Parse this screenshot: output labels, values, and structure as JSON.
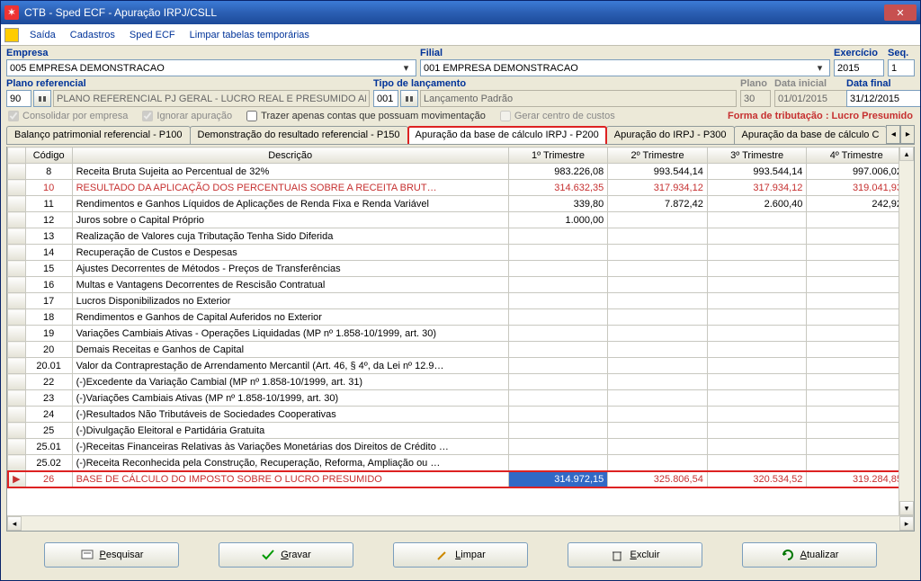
{
  "title": "CTB - Sped ECF - Apuração IRPJ/CSLL",
  "menu": {
    "saida": "Saída",
    "cadastros": "Cadastros",
    "sped": "Sped ECF",
    "limpar": "Limpar tabelas temporárias"
  },
  "fields": {
    "empresa": {
      "label": "Empresa",
      "value": "005 EMPRESA DEMONSTRACAO"
    },
    "filial": {
      "label": "Filial",
      "value": "001 EMPRESA DEMONSTRACAO"
    },
    "exercicio": {
      "label": "Exercício",
      "value": "2015"
    },
    "seq": {
      "label": "Seq.",
      "value": "1"
    },
    "plano_ref": {
      "label": "Plano referencial",
      "code": "90",
      "value": "PLANO REFERENCIAL PJ GERAL - LUCRO REAL E PRESUMIDO AN"
    },
    "tipo_lanc": {
      "label": "Tipo de lançamento",
      "code": "001",
      "value": "Lançamento Padrão"
    },
    "plano": {
      "label": "Plano",
      "value": "30"
    },
    "data_ini": {
      "label": "Data inicial",
      "value": "01/01/2015"
    },
    "data_fim": {
      "label": "Data final",
      "value": "31/12/2015"
    }
  },
  "checks": {
    "consolidar": "Consolidar por empresa",
    "ignorar": "Ignorar apuração",
    "trazer": "Trazer apenas contas que possuam movimentação",
    "gerar": "Gerar centro de custos"
  },
  "tribut": "Forma de tributação : Lucro Presumido",
  "tabs": [
    "Balanço patrimonial referencial - P100",
    "Demonstração do resultado referencial - P150",
    "Apuração da base de cálculo IRPJ - P200",
    "Apuração do IRPJ - P300",
    "Apuração da base de cálculo C"
  ],
  "grid": {
    "headers": [
      "Código",
      "Descrição",
      "1º Trimestre",
      "2º Trimestre",
      "3º Trimestre",
      "4º Trimestre"
    ],
    "rows": [
      {
        "c": "8",
        "d": "Receita Bruta Sujeita ao Percentual de 32%",
        "v": [
          "983.226,08",
          "993.544,14",
          "993.544,14",
          "997.006,02"
        ]
      },
      {
        "c": "10",
        "d": "RESULTADO DA APLICAÇÃO DOS PERCENTUAIS SOBRE A RECEITA BRUT…",
        "v": [
          "314.632,35",
          "317.934,12",
          "317.934,12",
          "319.041,93"
        ],
        "red": true
      },
      {
        "c": "11",
        "d": "Rendimentos e Ganhos Líquidos de Aplicações de Renda Fixa e Renda Variável",
        "v": [
          "339,80",
          "7.872,42",
          "2.600,40",
          "242,92"
        ]
      },
      {
        "c": "12",
        "d": "Juros sobre o Capital Próprio",
        "v": [
          "1.000,00",
          "",
          "",
          ""
        ]
      },
      {
        "c": "13",
        "d": "Realização de Valores cuja Tributação Tenha Sido Diferida",
        "v": [
          "",
          "",
          "",
          ""
        ]
      },
      {
        "c": "14",
        "d": "Recuperação de Custos e Despesas",
        "v": [
          "",
          "",
          "",
          ""
        ]
      },
      {
        "c": "15",
        "d": "Ajustes Decorrentes de Métodos - Preços de Transferências",
        "v": [
          "",
          "",
          "",
          ""
        ]
      },
      {
        "c": "16",
        "d": "Multas e Vantagens Decorrentes de Rescisão Contratual",
        "v": [
          "",
          "",
          "",
          ""
        ]
      },
      {
        "c": "17",
        "d": "Lucros Disponibilizados no Exterior",
        "v": [
          "",
          "",
          "",
          ""
        ]
      },
      {
        "c": "18",
        "d": "Rendimentos e Ganhos de Capital Auferidos no Exterior",
        "v": [
          "",
          "",
          "",
          ""
        ]
      },
      {
        "c": "19",
        "d": "Variações Cambiais Ativas - Operações Liquidadas (MP nº 1.858-10/1999, art. 30)",
        "v": [
          "",
          "",
          "",
          ""
        ]
      },
      {
        "c": "20",
        "d": "Demais Receitas e Ganhos de Capital",
        "v": [
          "",
          "",
          "",
          ""
        ]
      },
      {
        "c": "20.01",
        "d": "Valor da Contraprestação de Arrendamento Mercantil (Art. 46, § 4º, da Lei nº 12.9…",
        "v": [
          "",
          "",
          "",
          ""
        ]
      },
      {
        "c": "22",
        "d": "(-)Excedente da Variação Cambial (MP nº 1.858-10/1999, art. 31)",
        "v": [
          "",
          "",
          "",
          ""
        ]
      },
      {
        "c": "23",
        "d": "(-)Variações Cambiais Ativas (MP nº 1.858-10/1999, art. 30)",
        "v": [
          "",
          "",
          "",
          ""
        ]
      },
      {
        "c": "24",
        "d": "(-)Resultados Não Tributáveis de Sociedades Cooperativas",
        "v": [
          "",
          "",
          "",
          ""
        ]
      },
      {
        "c": "25",
        "d": "(-)Divulgação Eleitoral e Partidária Gratuita",
        "v": [
          "",
          "",
          "",
          ""
        ]
      },
      {
        "c": "25.01",
        "d": "(-)Receitas Financeiras Relativas às Variações Monetárias dos Direitos de Crédito …",
        "v": [
          "",
          "",
          "",
          ""
        ]
      },
      {
        "c": "25.02",
        "d": "(-)Receita Reconhecida pela Construção, Recuperação, Reforma, Ampliação ou …",
        "v": [
          "",
          "",
          "",
          ""
        ]
      },
      {
        "c": "26",
        "d": "BASE DE CÁLCULO DO IMPOSTO SOBRE O LUCRO PRESUMIDO",
        "v": [
          "314.972,15",
          "325.806,54",
          "320.534,52",
          "319.284,85"
        ],
        "red": true,
        "selected": true
      }
    ]
  },
  "buttons": {
    "pesquisar": "Pesquisar",
    "gravar": "Gravar",
    "limpar": "Limpar",
    "excluir": "Excluir",
    "atualizar": "Atualizar"
  }
}
